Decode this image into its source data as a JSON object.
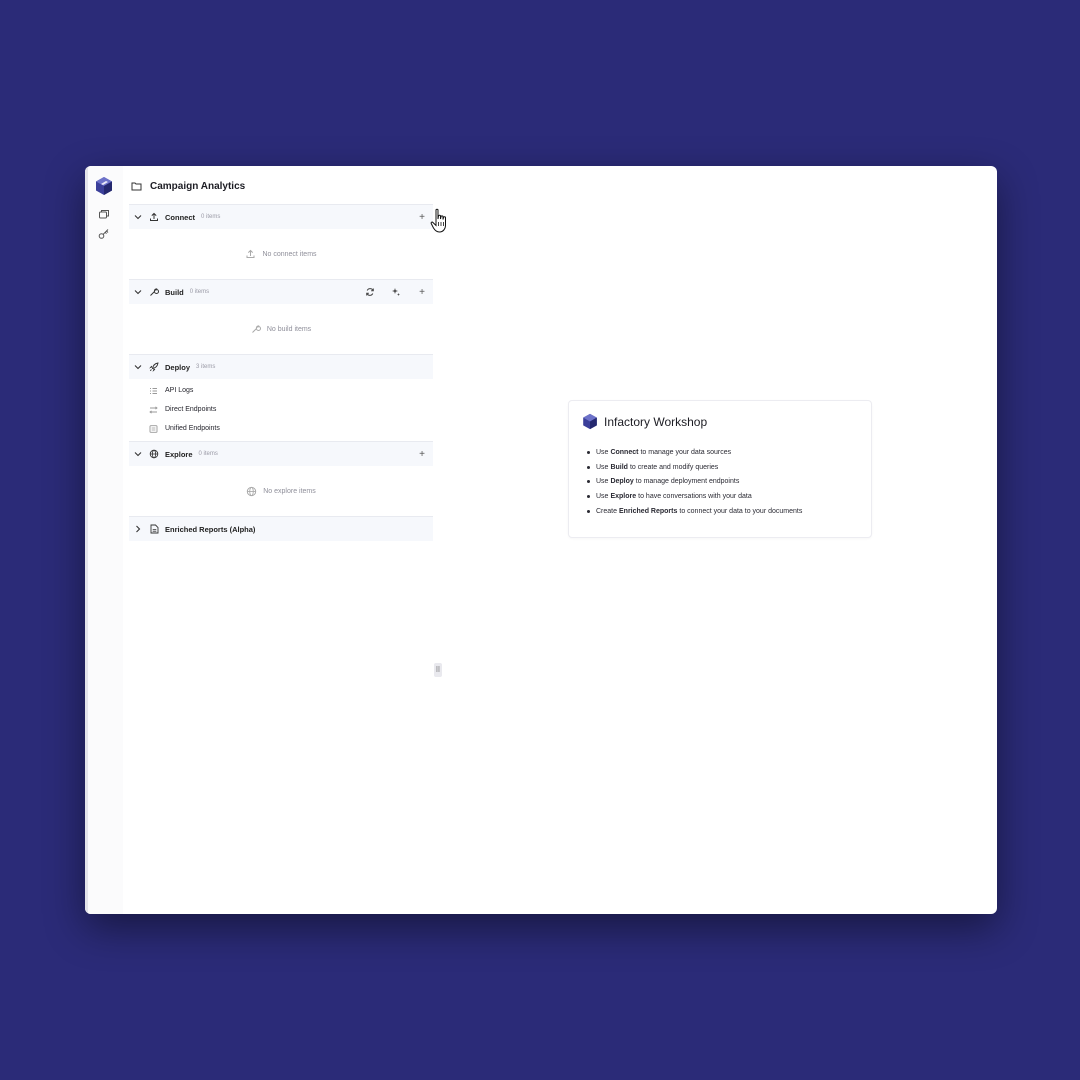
{
  "app": {
    "project_title": "Campaign Analytics"
  },
  "sections": {
    "connect": {
      "title": "Connect",
      "count": "0 items",
      "empty": "No connect items"
    },
    "build": {
      "title": "Build",
      "count": "0 items",
      "empty": "No build items"
    },
    "deploy": {
      "title": "Deploy",
      "count": "3 items",
      "items": [
        "API Logs",
        "Direct Endpoints",
        "Unified Endpoints"
      ]
    },
    "explore": {
      "title": "Explore",
      "count": "0 items",
      "empty": "No explore items"
    },
    "reports": {
      "title": "Enriched Reports (Alpha)"
    }
  },
  "welcome": {
    "title": "Infactory Workshop",
    "lines": [
      {
        "pre": "Use",
        "bold": "Connect",
        "post": "to manage your data sources"
      },
      {
        "pre": "Use",
        "bold": "Build",
        "post": "to create and modify queries"
      },
      {
        "pre": "Use",
        "bold": "Deploy",
        "post": "to manage deployment endpoints"
      },
      {
        "pre": "Use",
        "bold": "Explore",
        "post": "to have conversations with your data"
      },
      {
        "pre": "Create",
        "bold": "Enriched Reports",
        "post": "to connect your data to your documents"
      }
    ]
  },
  "colors": {
    "background": "#2b2b78",
    "brand": "#3b3f9a",
    "section_header": "#f6f8fc"
  },
  "icons": {
    "logo": "cube-logo-icon",
    "folder": "folder-icon",
    "add": "plus-icon",
    "refresh": "refresh-icon",
    "sparkle": "sparkle-icon"
  }
}
